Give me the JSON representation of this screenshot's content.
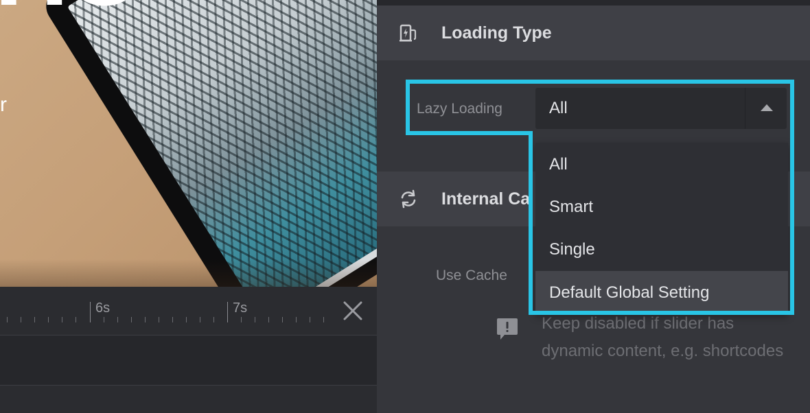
{
  "preview": {
    "big_text": "HO",
    "small_text": "r"
  },
  "timeline": {
    "tick_labels": [
      "6s",
      "7s"
    ]
  },
  "panel": {
    "loading_section": {
      "title": "Loading Type",
      "icon": "charging-station-icon"
    },
    "lazy_loading": {
      "label": "Lazy Loading",
      "selected": "All",
      "options": [
        "All",
        "Smart",
        "Single",
        "Default Global Setting"
      ],
      "hovered_option": "Default Global Setting"
    },
    "cache_section": {
      "title": "Internal Ca",
      "icon": "refresh-icon"
    },
    "use_cache": {
      "label": "Use Cache",
      "help_text": "Keep disabled if slider has dynamic content, e.g. shortcodes",
      "help_icon": "comment-alert-icon"
    }
  },
  "colors": {
    "highlight": "#29c5e6",
    "panel_bg": "#35363b",
    "section_bg": "#3f4046"
  }
}
